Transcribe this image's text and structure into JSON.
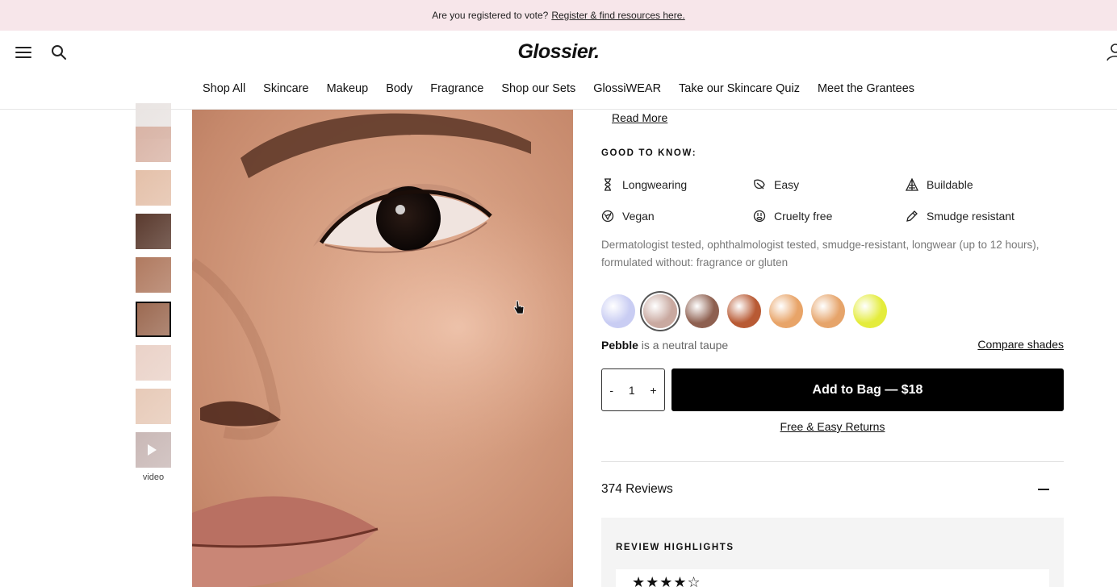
{
  "announcement": {
    "text": "Are you registered to vote?",
    "link": "Register & find resources here."
  },
  "header": {
    "logo": "Glossier.",
    "nav": [
      "Shop All",
      "Skincare",
      "Makeup",
      "Body",
      "Fragrance",
      "Shop our Sets",
      "GlossiWEAR",
      "Take our Skincare Quiz",
      "Meet the Grantees"
    ]
  },
  "gallery": {
    "video_label": "video",
    "thumb_colors": [
      "#e9e4e2",
      "#d9b4a6",
      "#e4c0a9",
      "#5a3a2e",
      "#b07a60",
      "#9c6a52",
      "#ead2c8",
      "#e7cab8",
      "#c9b8b6"
    ]
  },
  "product": {
    "read_more": "Read More",
    "good_to_know_title": "GOOD TO KNOW:",
    "features": [
      {
        "label": "Longwearing",
        "icon": "hourglass-icon"
      },
      {
        "label": "Easy",
        "icon": "leaf-icon"
      },
      {
        "label": "Buildable",
        "icon": "triangle-layers-icon"
      },
      {
        "label": "Vegan",
        "icon": "vegan-icon"
      },
      {
        "label": "Cruelty free",
        "icon": "rabbit-icon"
      },
      {
        "label": "Smudge resistant",
        "icon": "pencil-icon"
      }
    ],
    "description": "Dermatologist tested, ophthalmologist tested, smudge-resistant, longwear (up to 12 hours), formulated without: fragrance or gluten",
    "swatches": [
      "#c9cdf3",
      "#c9a9a0",
      "#8e6050",
      "#b85a34",
      "#e8a468",
      "#e6a46a",
      "#e4ec3c"
    ],
    "selected_swatch": 1,
    "shade_name": "Pebble",
    "shade_desc": "is a neutral taupe",
    "compare_label": "Compare shades",
    "qty_minus": "-",
    "qty_value": "1",
    "qty_plus": "+",
    "add_to_bag": "Add to Bag — $18",
    "returns": "Free & Easy Returns"
  },
  "reviews": {
    "count_label": "374 Reviews",
    "highlights_title": "REVIEW HIGHLIGHTS",
    "stars": "★★★★☆"
  }
}
